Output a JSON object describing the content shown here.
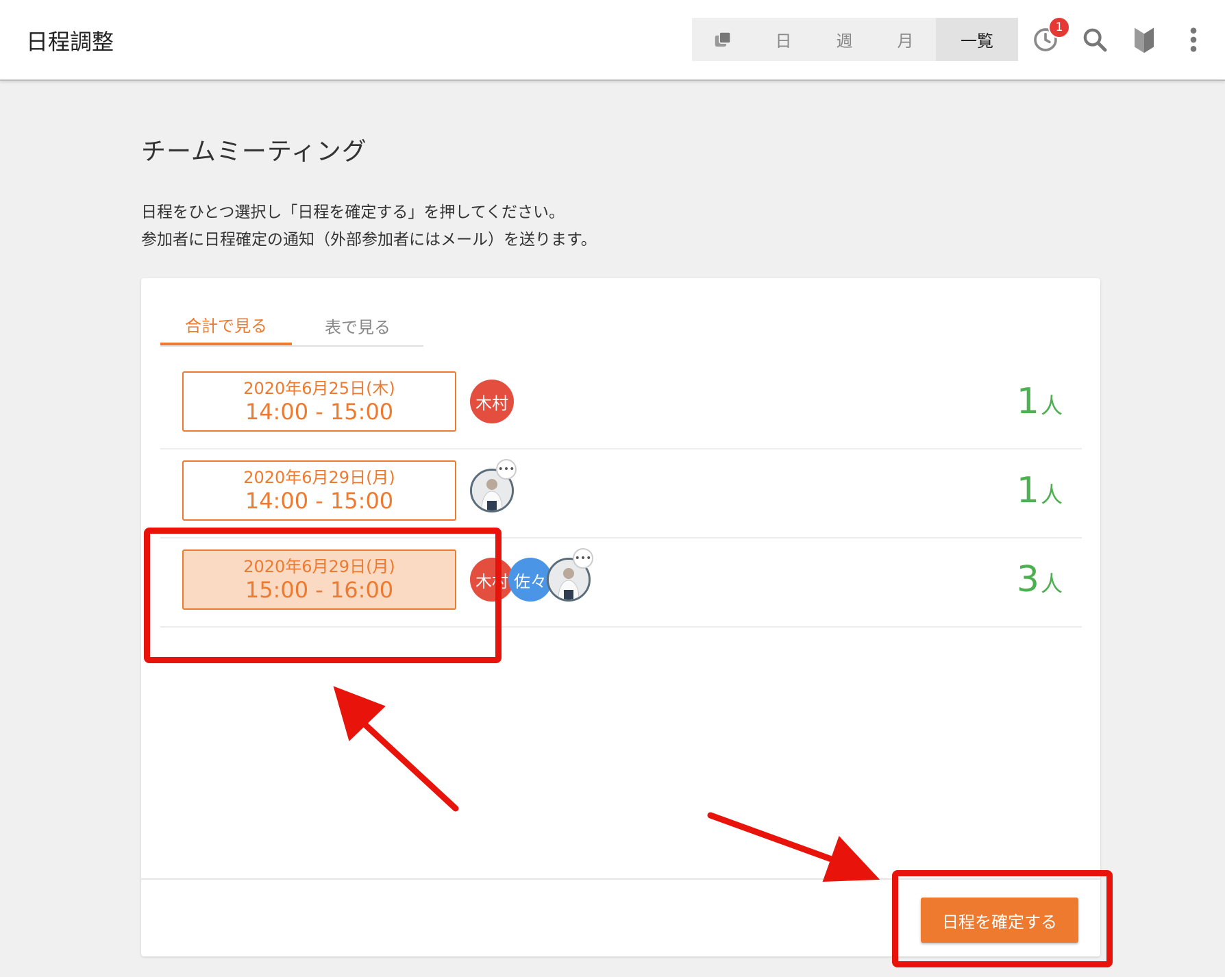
{
  "header": {
    "title": "日程調整",
    "view_switch": [
      "日",
      "週",
      "月",
      "一覧"
    ],
    "active_view": "一覧",
    "history_badge": "1"
  },
  "page": {
    "title": "チームミーティング",
    "desc_line1": "日程をひとつ選択し「日程を確定する」を押してください。",
    "desc_line2": "参加者に日程確定の通知（外部参加者にはメール）を送ります。"
  },
  "tabs": [
    {
      "label": "合計で見る",
      "active": true
    },
    {
      "label": "表で見る",
      "active": false
    }
  ],
  "slots": [
    {
      "date": "2020年6月25日(木)",
      "time": "14:00 - 15:00",
      "selected": false,
      "avatars": [
        {
          "type": "initials",
          "text": "木村",
          "color": "#e34e3f"
        }
      ],
      "count": "1",
      "unit": "人"
    },
    {
      "date": "2020年6月29日(月)",
      "time": "14:00 - 15:00",
      "selected": false,
      "avatars": [
        {
          "type": "photo",
          "dots": "•••"
        }
      ],
      "count": "1",
      "unit": "人"
    },
    {
      "date": "2020年6月29日(月)",
      "time": "15:00 - 16:00",
      "selected": true,
      "avatars": [
        {
          "type": "initials",
          "text": "木村",
          "color": "#e34e3f"
        },
        {
          "type": "initials",
          "text": "佐々",
          "color": "#4a95e6"
        },
        {
          "type": "photo",
          "dots": "•••"
        }
      ],
      "count": "3",
      "unit": "人"
    }
  ],
  "confirm_button": "日程を確定する",
  "colors": {
    "accent": "#ee7a30",
    "count_green": "#4caf50",
    "annotation_red": "#e8140c",
    "badge_red": "#e53935"
  },
  "icons": [
    "copy-icon",
    "history-clock-icon",
    "search-icon",
    "beginner-mark-icon",
    "more-vert-icon"
  ]
}
